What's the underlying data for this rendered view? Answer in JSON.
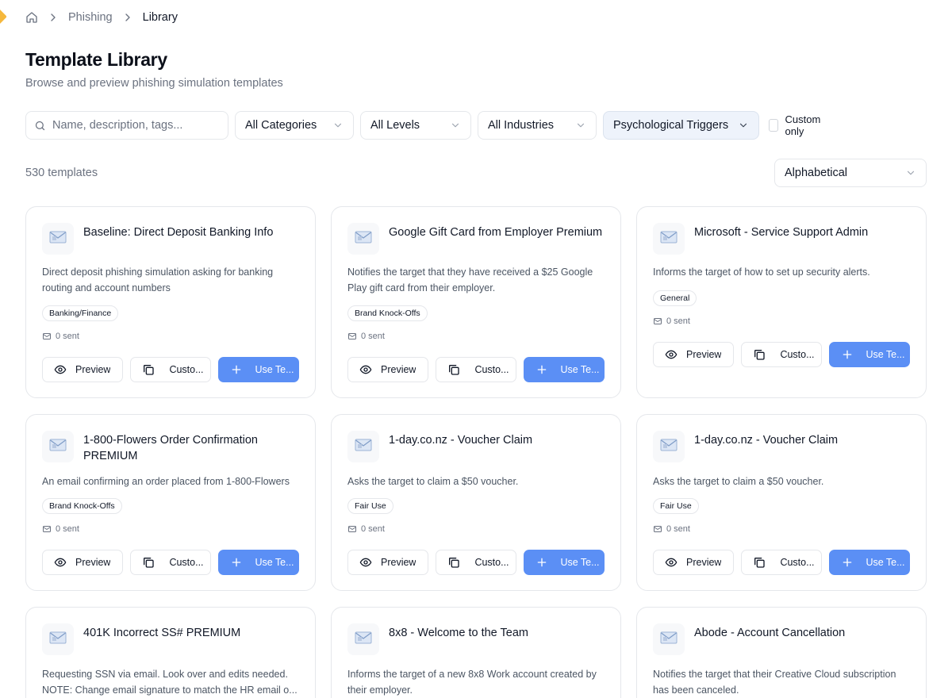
{
  "breadcrumb": {
    "items": [
      "Phishing",
      "Library"
    ]
  },
  "header": {
    "title": "Template Library",
    "subtitle": "Browse and preview phishing simulation templates"
  },
  "filters": {
    "search_placeholder": "Name, description, tags...",
    "categories": "All Categories",
    "levels": "All Levels",
    "industries": "All Industries",
    "triggers": "Psychological Triggers",
    "custom_only": "Custom only"
  },
  "results": {
    "count": "530 templates",
    "sort": "Alphabetical"
  },
  "actions": {
    "preview": "Preview",
    "customize": "Custo...",
    "use": "Use Te..."
  },
  "templates": [
    {
      "title": "Baseline: Direct Deposit Banking Info",
      "desc_lines": [
        "Direct deposit phishing simulation asking for banking",
        "routing and account numbers"
      ],
      "tag": "Banking/Finance",
      "sent": "0 sent"
    },
    {
      "title": "Google Gift Card from Employer Premium",
      "desc_lines": [
        "Notifies the target that they have received a $25 Google",
        "Play gift card from their employer."
      ],
      "tag": "Brand Knock-Offs",
      "sent": "0 sent"
    },
    {
      "title": "Microsoft - Service Support Admin",
      "desc_lines": [
        "Informs the target of how to set up security alerts."
      ],
      "tag": "General",
      "sent": "0 sent"
    },
    {
      "title": "1-800-Flowers Order Confirmation PREMIUM",
      "desc_lines": [
        "An email confirming an order placed from 1-800-Flowers"
      ],
      "tag": "Brand Knock-Offs",
      "sent": "0 sent"
    },
    {
      "title": "1-day.co.nz - Voucher Claim",
      "desc_lines": [
        "Asks the target to claim a $50 voucher."
      ],
      "tag": "Fair Use",
      "sent": "0 sent"
    },
    {
      "title": "1-day.co.nz - Voucher Claim",
      "desc_lines": [
        "Asks the target to claim a $50 voucher."
      ],
      "tag": "Fair Use",
      "sent": "0 sent"
    },
    {
      "title": "401K Incorrect SS# PREMIUM",
      "desc_lines": [
        "Requesting SSN via email. Look over and edits needed.",
        "NOTE: Change email signature to match the HR email o..."
      ]
    },
    {
      "title": "8x8 - Welcome to the Team",
      "desc_lines": [
        "Informs the target of a new 8x8 Work account created by",
        "their employer."
      ]
    },
    {
      "title": "Abode - Account Cancellation",
      "desc_lines": [
        "Notifies the target that their Creative Cloud subscription",
        "has been canceled."
      ]
    }
  ]
}
